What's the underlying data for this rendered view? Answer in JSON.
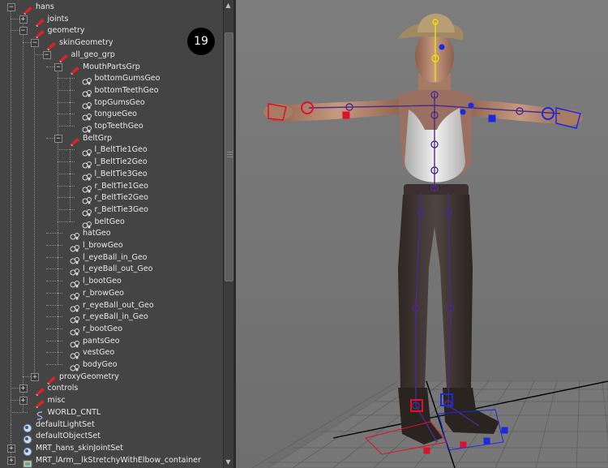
{
  "step_badge": "19",
  "outliner": {
    "items": [
      {
        "label": "hans",
        "depth": 0,
        "toggle": "minus",
        "icon": "transform-group-icon"
      },
      {
        "label": "joints",
        "depth": 1,
        "toggle": "plus",
        "icon": "transform-group-icon"
      },
      {
        "label": "geometry",
        "depth": 1,
        "toggle": "minus",
        "icon": "transform-group-icon"
      },
      {
        "label": "skinGeometry",
        "depth": 2,
        "toggle": "minus",
        "icon": "transform-group-icon"
      },
      {
        "label": "all_geo_grp",
        "depth": 3,
        "toggle": "minus",
        "icon": "transform-group-icon"
      },
      {
        "label": "MouthPartsGrp",
        "depth": 4,
        "toggle": "minus",
        "icon": "transform-group-icon"
      },
      {
        "label": "bottomGumsGeo",
        "depth": 5,
        "toggle": "none",
        "icon": "mesh-icon"
      },
      {
        "label": "bottomTeethGeo",
        "depth": 5,
        "toggle": "none",
        "icon": "mesh-icon"
      },
      {
        "label": "topGumsGeo",
        "depth": 5,
        "toggle": "none",
        "icon": "mesh-icon"
      },
      {
        "label": "tongueGeo",
        "depth": 5,
        "toggle": "none",
        "icon": "mesh-icon"
      },
      {
        "label": "topTeethGeo",
        "depth": 5,
        "toggle": "none",
        "icon": "mesh-icon"
      },
      {
        "label": "BeltGrp",
        "depth": 4,
        "toggle": "minus",
        "icon": "transform-group-icon"
      },
      {
        "label": "l_BeltTie1Geo",
        "depth": 5,
        "toggle": "none",
        "icon": "mesh-icon"
      },
      {
        "label": "l_BeltTie2Geo",
        "depth": 5,
        "toggle": "none",
        "icon": "mesh-icon"
      },
      {
        "label": "l_BeltTie3Geo",
        "depth": 5,
        "toggle": "none",
        "icon": "mesh-icon"
      },
      {
        "label": "r_BeltTie1Geo",
        "depth": 5,
        "toggle": "none",
        "icon": "mesh-icon"
      },
      {
        "label": "r_BeltTie2Geo",
        "depth": 5,
        "toggle": "none",
        "icon": "mesh-icon"
      },
      {
        "label": "r_BeltTie3Geo",
        "depth": 5,
        "toggle": "none",
        "icon": "mesh-icon"
      },
      {
        "label": "beltGeo",
        "depth": 5,
        "toggle": "none",
        "icon": "mesh-icon"
      },
      {
        "label": "hatGeo",
        "depth": 4,
        "toggle": "none",
        "icon": "mesh-icon"
      },
      {
        "label": "l_browGeo",
        "depth": 4,
        "toggle": "none",
        "icon": "mesh-icon"
      },
      {
        "label": "l_eyeBall_in_Geo",
        "depth": 4,
        "toggle": "none",
        "icon": "mesh-icon"
      },
      {
        "label": "l_eyeBall_out_Geo",
        "depth": 4,
        "toggle": "none",
        "icon": "mesh-icon"
      },
      {
        "label": "l_bootGeo",
        "depth": 4,
        "toggle": "none",
        "icon": "mesh-icon"
      },
      {
        "label": "r_browGeo",
        "depth": 4,
        "toggle": "none",
        "icon": "mesh-icon"
      },
      {
        "label": "r_eyeBall_out_Geo",
        "depth": 4,
        "toggle": "none",
        "icon": "mesh-icon"
      },
      {
        "label": "r_eyeBall_in_Geo",
        "depth": 4,
        "toggle": "none",
        "icon": "mesh-icon"
      },
      {
        "label": "r_bootGeo",
        "depth": 4,
        "toggle": "none",
        "icon": "mesh-icon"
      },
      {
        "label": "pantsGeo",
        "depth": 4,
        "toggle": "none",
        "icon": "mesh-icon"
      },
      {
        "label": "vestGeo",
        "depth": 4,
        "toggle": "none",
        "icon": "mesh-icon"
      },
      {
        "label": "bodyGeo",
        "depth": 4,
        "toggle": "none",
        "icon": "mesh-icon"
      },
      {
        "label": "proxyGeometry",
        "depth": 2,
        "toggle": "plus",
        "icon": "transform-group-icon"
      },
      {
        "label": "controls",
        "depth": 1,
        "toggle": "plus",
        "icon": "transform-group-icon"
      },
      {
        "label": "misc",
        "depth": 1,
        "toggle": "plus",
        "icon": "transform-group-icon"
      },
      {
        "label": "WORLD_CNTL",
        "depth": 1,
        "toggle": "none",
        "icon": "curve-icon"
      },
      {
        "label": "defaultLightSet",
        "depth": 0,
        "toggle": "none",
        "icon": "set-icon"
      },
      {
        "label": "defaultObjectSet",
        "depth": 0,
        "toggle": "none",
        "icon": "set-icon"
      },
      {
        "label": "MRT_hans_skinJointSet",
        "depth": 0,
        "toggle": "plus",
        "icon": "set-icon"
      },
      {
        "label": "MRT_lArm__lkStretchyWithElbow_container",
        "depth": 0,
        "toggle": "plus",
        "icon": "container-icon"
      }
    ]
  },
  "viewport": {
    "background": "#7a7a7a",
    "grid_color": "#5a5a5a",
    "joint_color": "#4b2a8a",
    "left_control_color": "#e0102a",
    "right_control_color": "#1a2ae0",
    "head_curve_color": "#f0e000"
  }
}
